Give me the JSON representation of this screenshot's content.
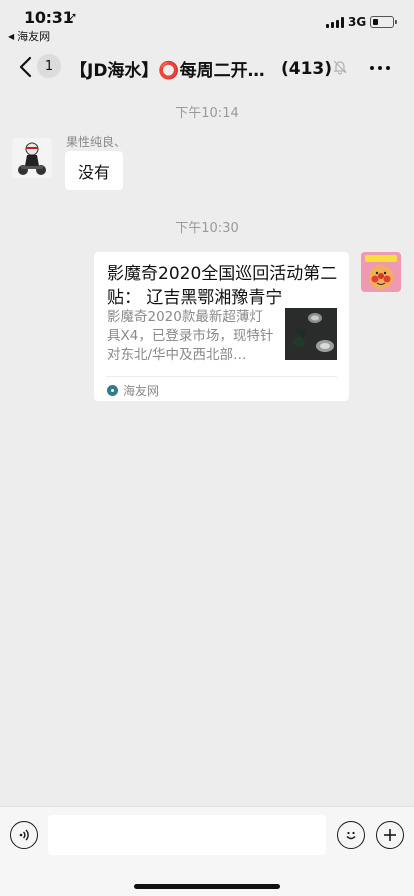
{
  "status_bar": {
    "time": "10:31",
    "back_app": "海友网",
    "network": "3G",
    "battery_level": 0.3
  },
  "nav": {
    "unread_count": "1",
    "title": "【JD海水】⭕每周二开团…",
    "member_count": "(413)",
    "icons": [
      "back-chevron-icon",
      "mute-bell-icon",
      "more-icon"
    ]
  },
  "chat": {
    "messages": [
      {
        "time_label": "下午10:14",
        "sender": "果性纯良、",
        "text": "没有",
        "side": "left"
      },
      {
        "time_label": "下午10:30",
        "side": "right",
        "type": "link-card",
        "card": {
          "title": "影魔奇2020全国巡回活动第二贴： 辽吉黑鄂湘豫青宁",
          "description": "影魔奇2020款最新超薄灯具X4，已登录市场，现特针对东北/华中及西北部…",
          "source": "海友网"
        }
      }
    ]
  },
  "input_bar": {
    "placeholder": "",
    "icons": [
      "voice-icon",
      "emoji-icon",
      "plus-icon"
    ]
  },
  "colors": {
    "background": "#ededed",
    "bubble": "#ffffff",
    "time_label": "#9a9a9a"
  }
}
